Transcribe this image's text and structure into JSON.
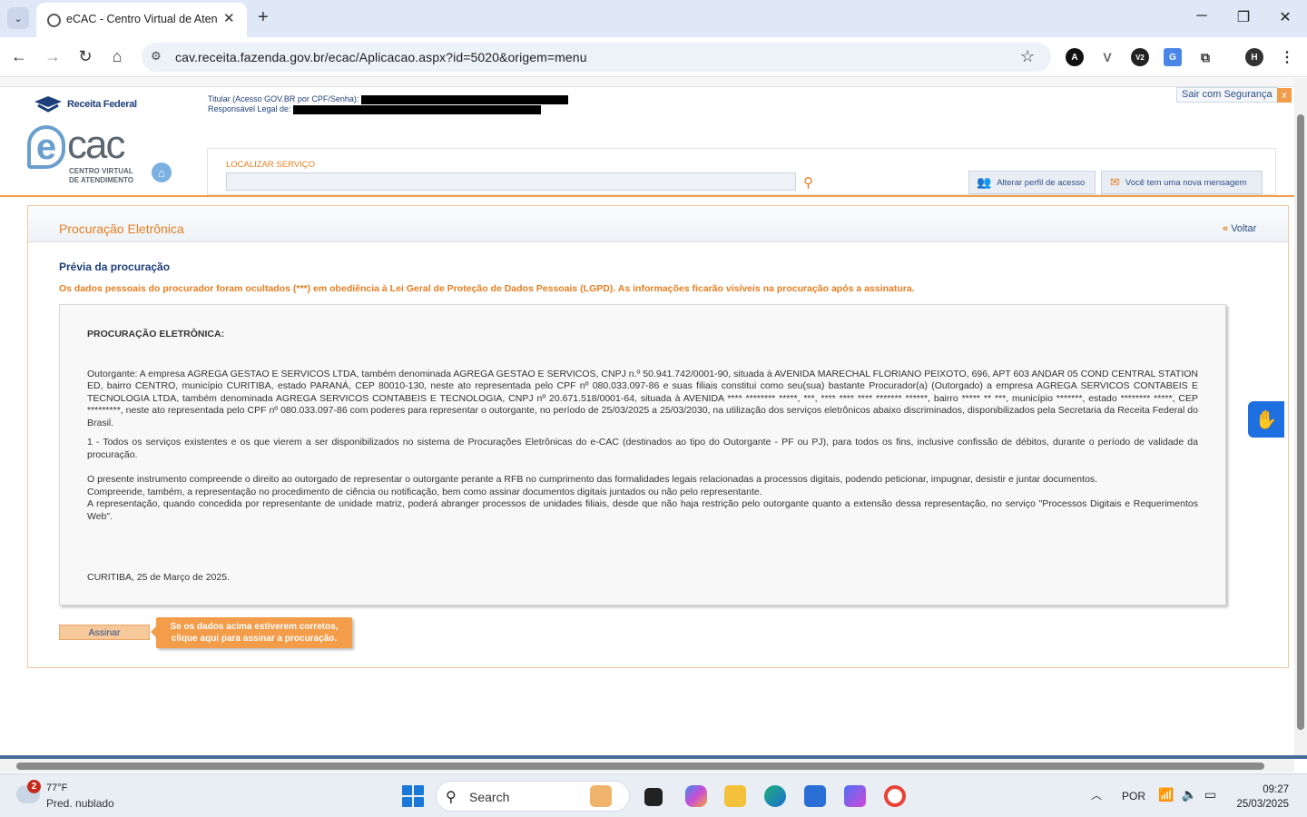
{
  "browser": {
    "tab_title": "eCAC - Centro Virtual de Atendimento",
    "new_tab": "+",
    "minimize": "─",
    "restore": "❐",
    "close": "✕",
    "url": "cav.receita.fazenda.gov.br/ecac/Aplicacao.aspx?id=5020&origem=menu",
    "extensions": [
      "A",
      "V",
      "V2",
      "G",
      "H"
    ]
  },
  "header": {
    "rf_logo": "Receita Federal",
    "titular_label": "Titular (Acesso GOV.BR por CPF/Senha):",
    "responsavel_label": "Responsável Legal de:",
    "sair": "Sair com Segurança",
    "sair_close": "x",
    "ecac_e": "e",
    "ecac_cac": "cac",
    "ecac_sub1": "CENTRO VIRTUAL",
    "ecac_sub2": "DE ATENDIMENTO",
    "search_label": "LOCALIZAR SERVIÇO",
    "search_value": "",
    "btn_perfil": "Alterar perfil de acesso",
    "btn_msg": "Você tem uma nova mensagem"
  },
  "content": {
    "title": "Procuração Eletrônica",
    "voltar": "Voltar",
    "previa": "Prévia da procuração",
    "lgpd": "Os dados pessoais do procurador foram ocultados (***) em obediência à Lei Geral de Proteção de Dados Pessoais (LGPD). As informações ficarão visíveis na procuração após a assinatura.",
    "doc_title": "PROCURAÇÃO ELETRÔNICA:",
    "doc_p1": "Outorgante: A empresa AGREGA GESTAO E SERVICOS LTDA, também denominada AGREGA GESTAO E SERVICOS, CNPJ n.º 50.941.742/0001-90, situada à AVENIDA MARECHAL FLORIANO PEIXOTO, 696, APT 603 ANDAR 05 COND CENTRAL STATION ED, bairro CENTRO, município CURITIBA, estado PARANÁ, CEP 80010-130, neste ato representada pelo CPF nº 080.033.097-86 e suas filiais constitui como seu(sua) bastante Procurador(a) (Outorgado) a empresa AGREGA SERVICOS CONTABEIS E TECNOLOGIA LTDA, também denominada AGREGA SERVICOS CONTABEIS E TECNOLOGIA, CNPJ nº 20.671.518/0001-64, situada à AVENIDA **** ******** *****, ***, **** **** **** ******* ******, bairro ***** ** ***, município *******, estado ******** *****, CEP *********, neste ato representada pelo CPF nº 080.033.097-86 com poderes para representar o outorgante, no período de 25/03/2025 a 25/03/2030, na utilização dos serviços eletrônicos abaixo discriminados, disponibilizados pela Secretaria da Receita Federal do Brasil.",
    "doc_p2": "1 - Todos os serviços existentes e os que vierem a ser disponibilizados no sistema de Procurações Eletrônicas do e-CAC (destinados ao tipo do Outorgante - PF ou PJ), para todos os fins, inclusive confissão de débitos, durante o período de validade da procuração.",
    "doc_p3a": "O presente instrumento compreende o direito ao outorgado de representar o outorgante perante a RFB no cumprimento das formalidades legais relacionadas a processos digitais, podendo peticionar, impugnar, desistir e juntar documentos.",
    "doc_p3b": "Compreende, também, a representação no procedimento de ciência ou notificação, bem como assinar documentos digitais juntados ou não pelo representante.",
    "doc_p3c": "A representação, quando concedida por representante de unidade matriz, poderá abranger processos de unidades filiais, desde que não haja restrição pelo outorgante quanto a extensão dessa representação, no serviço \"Processos Digitais e Requerimentos Web\".",
    "doc_place_date": "CURITIBA, 25 de Março de 2025.",
    "assinar": "Assinar",
    "tooltip_l1": "Se os dados acima estiverem corretos,",
    "tooltip_l2": "clique aqui para assinar a procuração."
  },
  "taskbar": {
    "weather_badge": "2",
    "temp": "77°F",
    "cond": "Pred. nublado",
    "search": "Search",
    "lang": "POR",
    "time": "09:27",
    "date": "25/03/2025"
  },
  "colors": {
    "accent": "#f39c4a",
    "link": "#2d4f86",
    "title": "#e67e22"
  }
}
